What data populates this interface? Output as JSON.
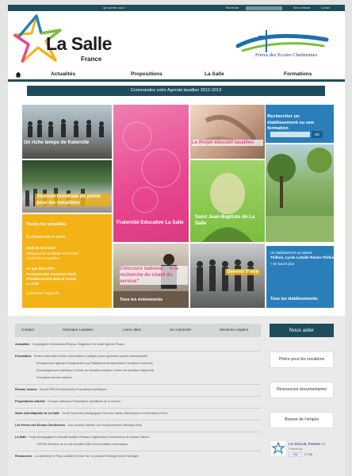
{
  "topbar": {
    "left_link": "Qui sommes-nous ?",
    "search_label": "Rechercher",
    "contact": "Nous contacter",
    "contact_short": "Contact"
  },
  "logo": {
    "name": "La Salle",
    "sub": "France"
  },
  "partner_logo": {
    "text": "Frères des Ecoles Chrétiennes"
  },
  "nav": {
    "items": [
      "Actualités",
      "Propositions",
      "La Salle",
      "Formations"
    ]
  },
  "banner": "Commandez votre Agenda lasallien 2012-2013",
  "tiles": {
    "t1_caption": "Un riche temps de fraternité",
    "t2_caption": "Journée mondiale de prière pour les vocations",
    "t3_caption": "Le Projet éducatif lasallien",
    "t4_caption": "Fraternité Educative La Salle",
    "t5_caption": "Saint Jean-Baptiste de La Salle",
    "t6_caption": "Concours national : \"A la recherche du chant du service\"",
    "t7_caption": "Devenir Frère",
    "t8_caption": "Tous les évènements",
    "search_title": "Rechercher un établissement ou une formation",
    "search_placeholder": "",
    "search_ok": "OK"
  },
  "yellow_list": {
    "line1": "Toutes les actualités",
    "line2": "Événements à venir",
    "line3": "jeudi 26 avril 2012",
    "line4": "Obsèques du Morbihan avec Frère",
    "line5": "André-Pierre Gauthier",
    "line6": "Ce que fait la fête",
    "line7": "Formation des nouveaux chefs",
    "line8": "d'établissement dans le réseau",
    "line9": "La Salle",
    "line10": "Calendrier l'agenda"
  },
  "blue_info": {
    "line1": "Un établissement au hasard",
    "line2": "Thillois, Lycée LaSalle Reims-Thillois",
    "line3": "> En savoir plus",
    "link": "Tous les établissements"
  },
  "footer": {
    "bar_items": [
      "Contact",
      "Glossaire Lasallien",
      "Liens utiles",
      "Se connecter",
      "Mentions Légales"
    ],
    "nous_aider": "Nous aider",
    "rows": [
      {
        "title": "Actualités",
        "links": "Congrégation   International   Réseau   Obligations   Vie locale   Agenda   Photos"
      },
      {
        "title": "Formations",
        "links": "Écoles maternelles   Écoles élémentaires   Collèges   Lycées généraux   Lycées professionnels"
      },
      {
        "title": "",
        "links": "Enseignement agricole   Enseignement sup   Établissements spécialisés   Formations continues"
      },
      {
        "title": "",
        "links": "Accompagnement spécifique   Centres de formation continue   Centres de formation d'apprentis"
      },
      {
        "title": "",
        "links": "Formations      Bureau d'études"
      },
      {
        "title": "Réseau Jeunes",
        "links": "Accueil   RENJS   Evénements   Propositions spécifiques"
      },
      {
        "title": "Propositions Adultes",
        "links": "Groupes nationaux   Propositions spécifiques de la réunion"
      },
      {
        "title": "Saint Jean-Baptiste de La Salle",
        "links": "Sa vie   Sa pensée pédagogique   Ses lieux   Saints, Bienheureux et Vénérables Frères"
      },
      {
        "title": "Les Frères des Écoles Chrétiennes",
        "links": "Leur vocation   Identité   Leur fonctionnement   Historique   Blog"
      },
      {
        "title": "La Salle",
        "links": "Projet pédagogique et éducatif lasallien   Réseaux   Organisation   Gouvernance du réseau   Histoire"
      },
      {
        "title": "",
        "links": "CERFAL   Entretien de la voie   Actualité Salle   Documentation informatique"
      },
      {
        "title": "Ressources",
        "links": "La catéchèse en Pays Lasallien   Dernier titre du proposé   Rubrique photo   Ouvrages"
      }
    ],
    "side_buttons": [
      "Prière pour les vocations",
      "Ressources documentaires",
      "Bourse de l'emploi"
    ],
    "facebook": {
      "name": "LA SALLE, France",
      "suffix": "on",
      "platform": "Facebook",
      "like_label": "Like",
      "likes": "2,732"
    }
  },
  "colors": {
    "dark_teal": "#1e4c5c",
    "yellow": "#f3b316",
    "pink": "#e8468e",
    "green": "#7bbf3e",
    "blue": "#2a7fbb"
  }
}
